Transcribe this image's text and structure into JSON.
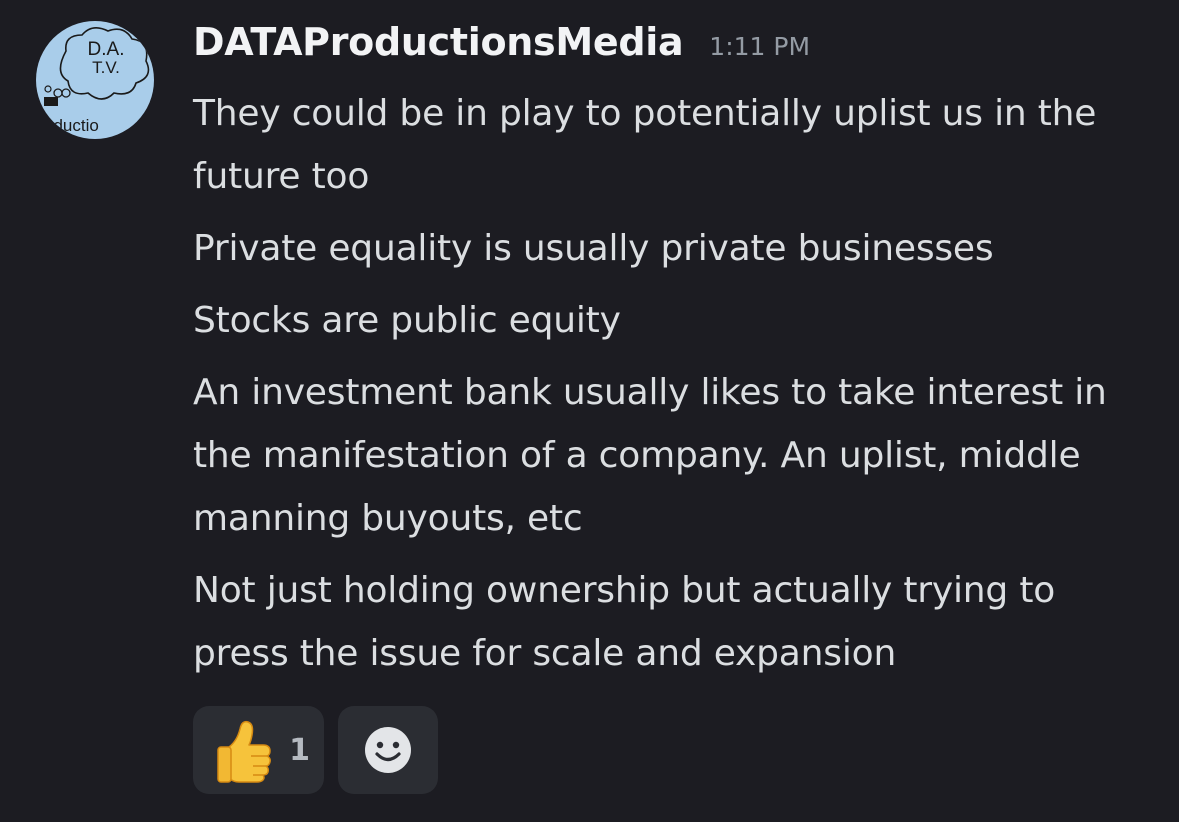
{
  "author": {
    "username": "DATAProductionsMedia",
    "timestamp": "1:11 PM",
    "avatar_text": {
      "line1": "D.A.",
      "line2": "T.V.",
      "line3": "oductio"
    }
  },
  "messages": [
    "They could be in play to potentially uplist us in the future too",
    "Private equality is usually private businesses",
    "Stocks are public equity",
    "An investment bank usually likes to take interest in the manifestation of a company. An uplist, middle manning buyouts, etc",
    "Not just holding ownership but actually trying to press the issue for scale and expansion"
  ],
  "reactions": {
    "thumbs_up": {
      "icon": "thumbs-up-icon",
      "count": "1"
    },
    "add_reaction": {
      "icon": "smiley-face-icon"
    }
  },
  "colors": {
    "background": "#1c1c22",
    "username": "#f2f3f5",
    "timestamp": "#949ba4",
    "message_text": "#dbdee1",
    "reaction_bg": "#2b2d33",
    "avatar_bg": "#a9cdea"
  }
}
